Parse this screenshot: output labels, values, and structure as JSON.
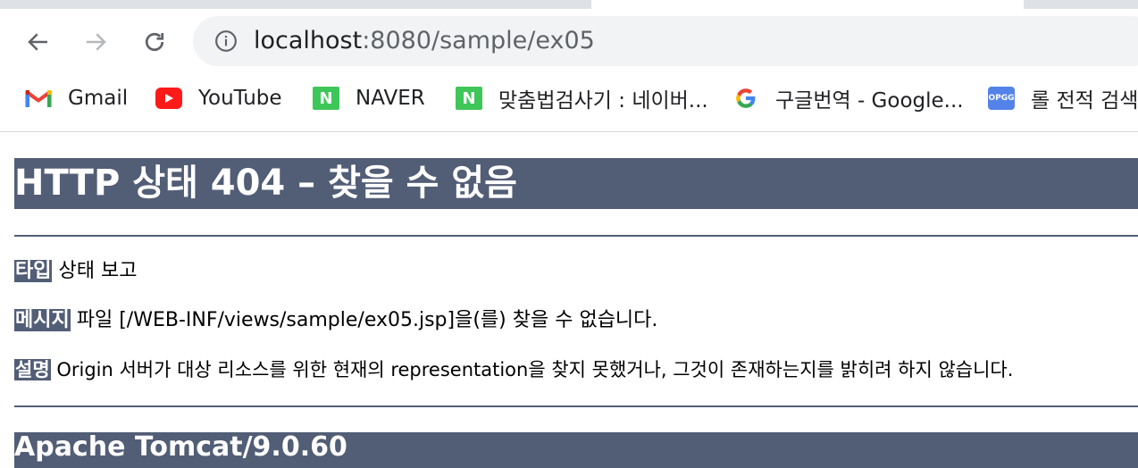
{
  "browser": {
    "url_host": "localhost",
    "url_path": ":8080/sample/ex05",
    "bookmarks": [
      {
        "label": "Gmail",
        "icon": "gmail-icon"
      },
      {
        "label": "YouTube",
        "icon": "youtube-icon"
      },
      {
        "label": "NAVER",
        "icon": "naver-icon"
      },
      {
        "label": "맞춤법검사기 : 네이버...",
        "icon": "naver-icon"
      },
      {
        "label": "구글번역 - Google...",
        "icon": "google-icon"
      },
      {
        "label": "롤 전적 검색",
        "icon": "opgg-icon"
      }
    ],
    "naver_letter": "N",
    "opgg_text": "OPGG"
  },
  "error_page": {
    "title": "HTTP 상태 404 – 찾을 수 없음",
    "type_label": "타입",
    "type_value": "상태 보고",
    "message_label": "메시지",
    "message_value": "파일 [/WEB-INF/views/sample/ex05.jsp]을(를) 찾을 수 없습니다.",
    "description_label": "설명",
    "description_value": "Origin 서버가 대상 리소스를 위한 현재의 representation을 찾지 못했거나, 그것이 존재하는지를 밝히려 하지 않습니다.",
    "footer": "Apache Tomcat/9.0.60"
  },
  "colors": {
    "tomcat_header_bg": "#525d76",
    "chrome_tabstrip": "#dee1e6",
    "omnibox_bg": "#f1f3f4"
  }
}
